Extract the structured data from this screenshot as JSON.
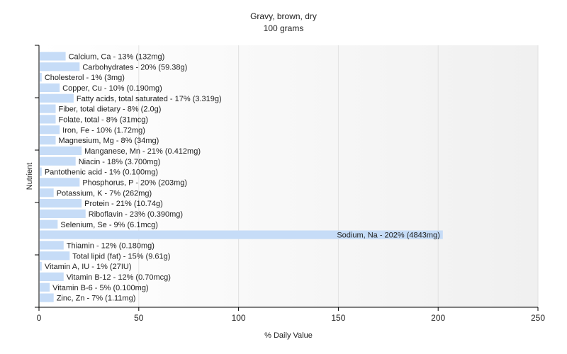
{
  "chart_data": {
    "type": "bar",
    "orientation": "horizontal",
    "title": "Gravy, brown, dry",
    "subtitle": "100 grams",
    "xlabel": "% Daily Value",
    "ylabel": "Nutrient",
    "xlim": [
      0,
      250
    ],
    "xticks": [
      0,
      50,
      100,
      150,
      200,
      250
    ],
    "grid": true,
    "bar_color": "#c6dcf7",
    "categories": [
      "Calcium, Ca",
      "Carbohydrates",
      "Cholesterol",
      "Copper, Cu",
      "Fatty acids, total saturated",
      "Fiber, total dietary",
      "Folate, total",
      "Iron, Fe",
      "Magnesium, Mg",
      "Manganese, Mn",
      "Niacin",
      "Pantothenic acid",
      "Phosphorus, P",
      "Potassium, K",
      "Protein",
      "Riboflavin",
      "Selenium, Se",
      "Sodium, Na",
      "Thiamin",
      "Total lipid (fat)",
      "Vitamin A, IU",
      "Vitamin B-12",
      "Vitamin B-6",
      "Zinc, Zn"
    ],
    "values": [
      13,
      20,
      1,
      10,
      17,
      8,
      8,
      10,
      8,
      21,
      18,
      1,
      20,
      7,
      21,
      23,
      9,
      202,
      12,
      15,
      1,
      12,
      5,
      7
    ],
    "labels": [
      "Calcium, Ca - 13% (132mg)",
      "Carbohydrates - 20% (59.38g)",
      "Cholesterol - 1% (3mg)",
      "Copper, Cu - 10% (0.190mg)",
      "Fatty acids, total saturated - 17% (3.319g)",
      "Fiber, total dietary - 8% (2.0g)",
      "Folate, total - 8% (31mcg)",
      "Iron, Fe - 10% (1.72mg)",
      "Magnesium, Mg - 8% (34mg)",
      "Manganese, Mn - 21% (0.412mg)",
      "Niacin - 18% (3.700mg)",
      "Pantothenic acid - 1% (0.100mg)",
      "Phosphorus, P - 20% (203mg)",
      "Potassium, K - 7% (262mg)",
      "Protein - 21% (10.74g)",
      "Riboflavin - 23% (0.390mg)",
      "Selenium, Se - 9% (6.1mcg)",
      "Sodium, Na - 202% (4843mg)",
      "Thiamin - 12% (0.180mg)",
      "Total lipid (fat) - 15% (9.61g)",
      "Vitamin A, IU - 1% (27IU)",
      "Vitamin B-12 - 12% (0.70mcg)",
      "Vitamin B-6 - 5% (0.100mg)",
      "Zinc, Zn - 7% (1.11mg)"
    ]
  }
}
